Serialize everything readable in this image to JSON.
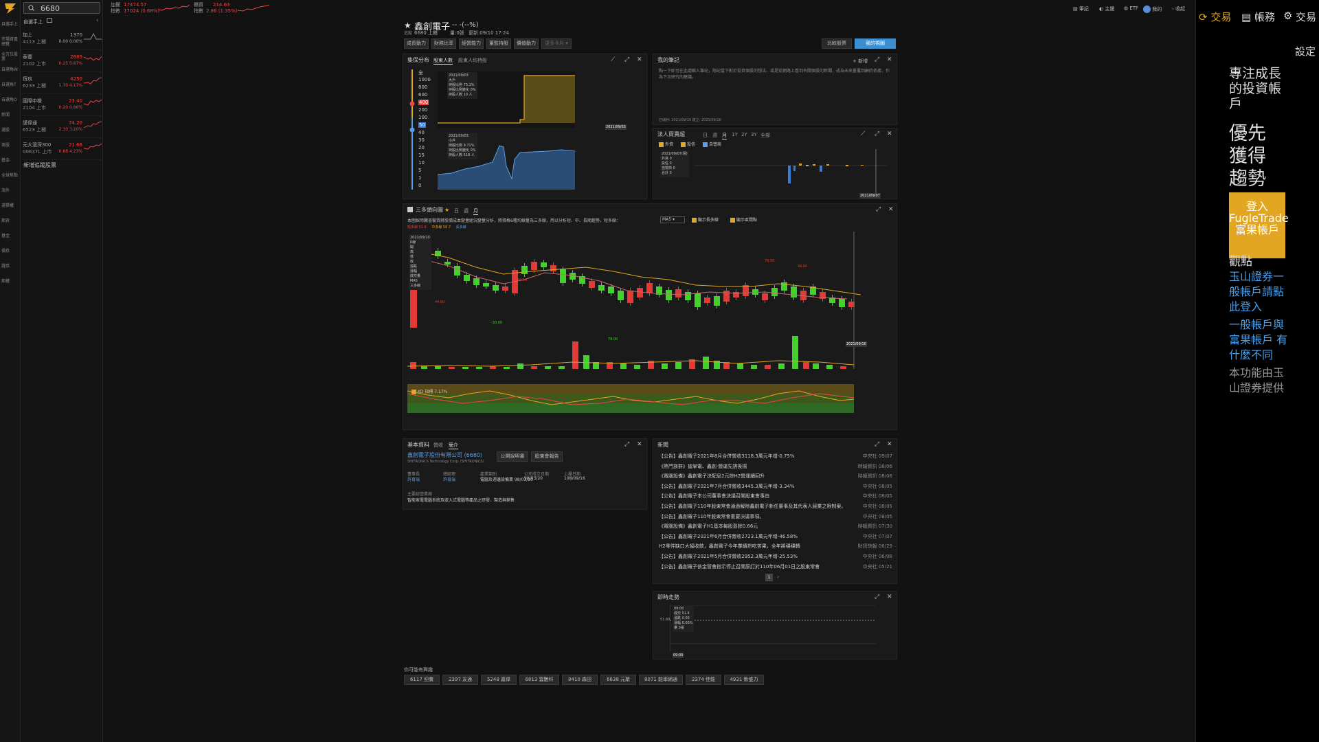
{
  "rail": {
    "items": [
      "自選手上",
      "市場資產總覽",
      "全方位股票",
      "自選角W",
      "自選角T",
      "自選角O",
      "新聞",
      "選股",
      "美股",
      "基金",
      "全球焦點",
      "海外",
      "選擇權",
      "期貨",
      "基金",
      "債券",
      "證券",
      "期權"
    ]
  },
  "watchlist": {
    "search_value": "6680",
    "group_label": "自選手上",
    "rows": [
      {
        "name": "加上",
        "sub": "4113 上櫃",
        "price": "1370",
        "change": "0.00 0.00%",
        "dir": "flat"
      },
      {
        "name": "泰豐",
        "sub": "2102 上市",
        "price": "2685",
        "change": "0.25 0.87%",
        "dir": "up"
      },
      {
        "name": "恆玖",
        "sub": "6233 上櫃",
        "price": "4250",
        "change": "1.70 4.17%",
        "dir": "up"
      },
      {
        "name": "國際中橡",
        "sub": "2104 上市",
        "price": "23.40",
        "change": "0.20 0.86%",
        "dir": "up"
      },
      {
        "name": "謹偉通",
        "sub": "6523 上櫃",
        "price": "74.20",
        "change": "2.30 3.20%",
        "dir": "up"
      },
      {
        "name": "元大滬深300",
        "sub": "00637L 上市",
        "price": "21.66",
        "change": "0.88 4.23%",
        "dir": "up"
      }
    ],
    "add_label": "新增追蹤股票"
  },
  "indices": [
    {
      "name": "加權\n指數",
      "value": "17474.57",
      "change": "17024 (0.68%)"
    },
    {
      "name": "櫃買\n指數",
      "value": "214.63",
      "change": "2.86 (1.35%)"
    }
  ],
  "topbar": {
    "items": [
      "筆記",
      "主題",
      "ETF",
      "我的",
      "收起"
    ]
  },
  "stock": {
    "name": "鑫創電子",
    "price_text": "-- -(--%)",
    "code": "6680 上櫃",
    "volume": "量:0張",
    "updated": "更新:09/10 17:24",
    "flag": "追蹤"
  },
  "nav_tabs": [
    "成長動力",
    "財務比率",
    "經營能力",
    "董監持股",
    "價值動力",
    "更多卡片"
  ],
  "compare_label": "比較股票",
  "my_view_label": "我的視圖",
  "holders": {
    "title": "集保分布",
    "tabs": [
      "股東人數",
      "股東人均持股"
    ],
    "levels": [
      "全",
      "1000",
      "800",
      "600",
      "400",
      "200",
      "100",
      "50",
      "40",
      "30",
      "20",
      "15",
      "10",
      "5",
      "1",
      "0"
    ],
    "top_tip": {
      "date": "2021/09/03",
      "rows": [
        "大戶",
        "持股比例 73.1%",
        "持股比例變化 0%",
        "持股人數 10 人"
      ]
    },
    "bottom_tip": {
      "date": "2021/09/03",
      "rows": [
        "小戶",
        "持股比例 9.71%",
        "持股比例變化 0%",
        "持股人數 518 人"
      ]
    },
    "date_label": "2021/09/03"
  },
  "notes": {
    "title": "我的筆記",
    "add_label": "+ 新增",
    "body": "點一下即可在此處輸入筆記，隨記當下對於投資個股的想法，或是從網路上看到有關個股的新聞，成為未來重覆回顧的依據，作為下次研究的建議。",
    "meta": "已儲存: 2021/09/10 建立: 2021/09/10"
  },
  "inst": {
    "title": "法人買賣超",
    "ranges": [
      "日",
      "週",
      "月",
      "1Y",
      "2Y",
      "3Y",
      "全部"
    ],
    "filters": [
      "外資",
      "投信",
      "自營商"
    ],
    "tip": {
      "date": "2021/09/07(週)",
      "rows": [
        "外資 0",
        "投信 0",
        "自營商 0",
        "合計 0"
      ]
    },
    "date_label": "2021/09/07"
  },
  "kline": {
    "title": "三多頭向圖",
    "ranges": [
      "日",
      "週",
      "月"
    ],
    "desc": "本圖採用騰普醫質將股價成本變量組況變量分析，將價格6種均線量為三多線，用以分析短、中、長期趨勢，短多線：",
    "ma_select": "MA5",
    "checks": [
      "顯示長多線",
      "顯示區間點"
    ],
    "legend": [
      "短多線 51.6",
      "中多線 56.7",
      "長多線"
    ],
    "tip": {
      "date": "2021/09/10",
      "rows": [
        "K線",
        "開",
        "高",
        "低",
        "收",
        "漲跌",
        "漲幅",
        "成交量",
        "MA5",
        "三多線"
      ]
    },
    "annotations": [
      "84.50",
      "44.80",
      "-30.00",
      "79.00",
      "79.50",
      "99.60"
    ],
    "kd_label": "KD 指標 7.17%",
    "date_label": "2021/09/10"
  },
  "profile": {
    "title": "基本資料",
    "tabs": [
      "營收",
      "簡介"
    ],
    "company": "鑫創電子股份有限公司 (6680)",
    "en": "SHITRONICS Technology Corp. (SHITRONICS)",
    "btn1": "公開說明書",
    "btn2": "股東會報告",
    "fields": [
      [
        "董事長",
        "許育瑞"
      ],
      [
        "總經理",
        "許育瑞"
      ],
      [
        "產業類別",
        "電腦及週邊設備業 98/03/20"
      ],
      [
        "公司成立日期",
        "98/03/20"
      ],
      [
        "上櫃日期",
        "108/09/16"
      ]
    ],
    "business_label": "主要經營業務",
    "business": "智能家電電腦系統及嵌入式電腦等產品之研發、製造與銷售"
  },
  "newsp": {
    "title": "新聞",
    "page": "1",
    "items": [
      {
        "t": "【公告】鑫創電子2021年8月合併營收3118.3萬元年增-0.75%",
        "s": "中央社 09/07"
      },
      {
        "t": "《熱門族群》搶掌電、鑫創·營運先誘後揚",
        "s": "時報資訊 08/06"
      },
      {
        "t": "《電腦設備》鑫創電子決配息2元拚H2營運續回升",
        "s": "時報資訊 08/06"
      },
      {
        "t": "【公告】鑫創電子2021年7月合併營收3445.3萬元年增-3.34%",
        "s": "中央社 08/05"
      },
      {
        "t": "【公告】鑫創電子本公司董事會決議召開股東會事由  ",
        "s": "中央社 08/05"
      },
      {
        "t": "【公告】鑫創電子110年股東常會通過解除鑫創電子新任董事及其代表人競業之限制案。",
        "s": "中央社 08/05"
      },
      {
        "t": "【公告】鑫創電子110年股東常會重要決議事項。",
        "s": "中央社 08/05"
      },
      {
        "t": "《電腦設備》鑫創電子H1基本每股盈餘0.66元",
        "s": "時報資訊 07/30"
      },
      {
        "t": "【公告】鑫創電子2021年6月合併營收2723.1萬元年增-46.58%",
        "s": "中央社 07/07"
      },
      {
        "t": "H2零件缺口大幅收斂，鑫創電子今年業績拚吃苦果，全年將穩穩轉",
        "s": "財訊快報 06/29"
      },
      {
        "t": "【公告】鑫創電子2021年5月合併營收2952.3萬元年增-25.53%",
        "s": "中央社 06/08"
      },
      {
        "t": "【公告】鑫創電子依金管會指示停止召開原訂於110年06月01日之股東常會",
        "s": "中央社 05/21"
      }
    ]
  },
  "intraday": {
    "title": "即時走勢",
    "y": "51.60",
    "tip": {
      "time": "09:00",
      "rows": [
        "成交 51.6",
        "漲跌 0.00",
        "漲幅 0.00%",
        "量 0張"
      ]
    },
    "time_label": "09:00"
  },
  "related": {
    "label": "你可能有興趣",
    "chips": [
      "6117 迎廣",
      "2397 友通",
      "5248 嘉偉",
      "6813 雲艷科",
      "8410 森田",
      "6638 元聚",
      "8071 能率網通",
      "2374 佳能",
      "4931 新盛力"
    ]
  },
  "right": {
    "trade": "交易",
    "account": "帳務",
    "settings": "設定",
    "trade2": "交易",
    "headline": "專注成長的投資帳戶",
    "slogan": "優先獲得趨勢",
    "login": "登入 FugleTrade富果帳戶",
    "tail": "觀點",
    "link1": "玉山證券一般帳戶請點此登入",
    "link2": "一般帳戶與富果帳戶 有什麼不同",
    "provider": "本功能由玉山證券提供"
  },
  "colors": {
    "up": "#e53935",
    "down": "#43d22c",
    "gold": "#e2a623",
    "blue": "#3a7bd5"
  }
}
